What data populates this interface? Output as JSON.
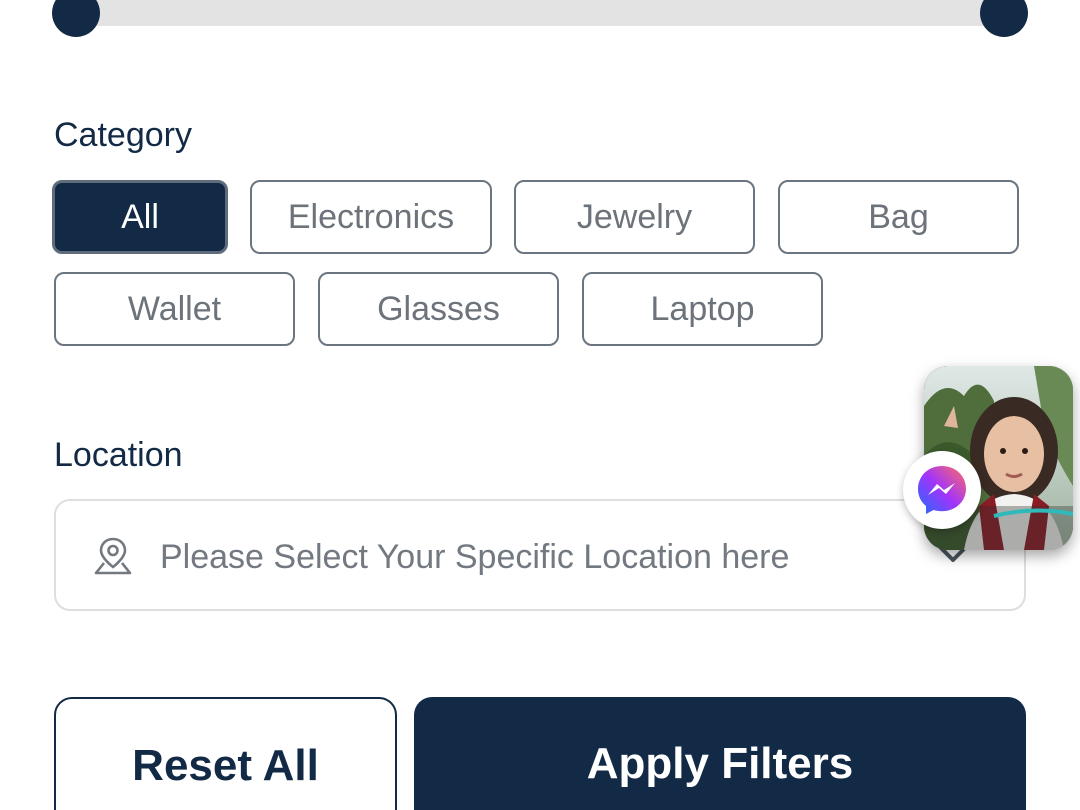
{
  "price_slider": {
    "track_color": "#e3e3e3",
    "thumb_color": "#132a46"
  },
  "category": {
    "label": "Category",
    "selected": "All",
    "options": [
      "All",
      "Electronics",
      "Jewelry",
      "Bag",
      "Wallet",
      "Glasses",
      "Laptop"
    ]
  },
  "location": {
    "label": "Location",
    "placeholder": "Please Select Your Specific Location here",
    "icon": "location-pin-icon",
    "dropdown_icon": "chevron-down-icon"
  },
  "actions": {
    "reset_label": "Reset All",
    "apply_label": "Apply Filters"
  },
  "chat_head": {
    "icon": "messenger-icon"
  },
  "colors": {
    "primary": "#132a46",
    "chip_text": "#6d737a",
    "chip_border": "#6b7580"
  }
}
